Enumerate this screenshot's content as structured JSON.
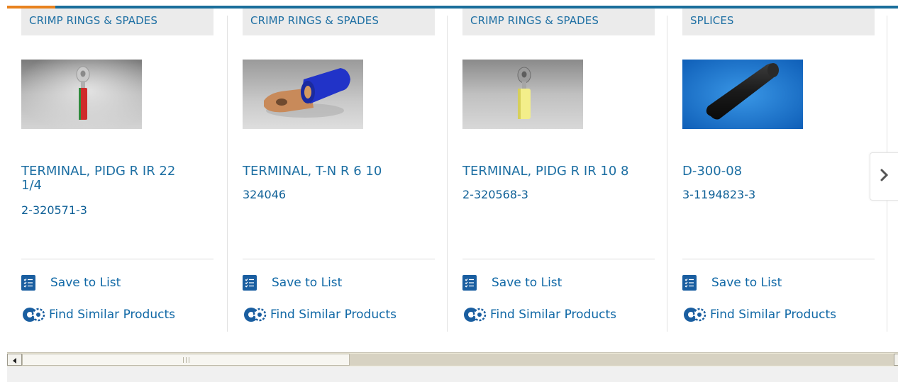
{
  "cards": [
    {
      "category": "CRIMP RINGS & SPADES",
      "title": "TERMINAL, PIDG R IR 22 1/4",
      "part_number": "2-320571-3",
      "image": "ring-terminal-red",
      "save_label": "Save to List",
      "find_label": "Find Similar Products"
    },
    {
      "category": "CRIMP RINGS & SPADES",
      "title": "TERMINAL, T-N R 6 10",
      "part_number": "324046",
      "image": "ring-terminal-blue",
      "save_label": "Save to List",
      "find_label": "Find Similar Products"
    },
    {
      "category": "CRIMP RINGS & SPADES",
      "title": "TERMINAL, PIDG R IR 10 8",
      "part_number": "2-320568-3",
      "image": "ring-terminal-yellow",
      "save_label": "Save to List",
      "find_label": "Find Similar Products"
    },
    {
      "category": "SPLICES",
      "title": "D-300-08",
      "part_number": "3-1194823-3",
      "image": "black-sleeve-splice",
      "save_label": "Save to List",
      "find_label": "Find Similar Products"
    }
  ],
  "colors": {
    "accent_orange": "#e8821e",
    "brand_blue": "#1a6e9b",
    "link_blue": "#1d6fa3",
    "category_bg": "#ebebeb"
  },
  "icons": {
    "save": "checklist-icon",
    "find": "gears-icon",
    "next": "chevron-right-icon",
    "scroll_left": "arrow-left-icon"
  }
}
